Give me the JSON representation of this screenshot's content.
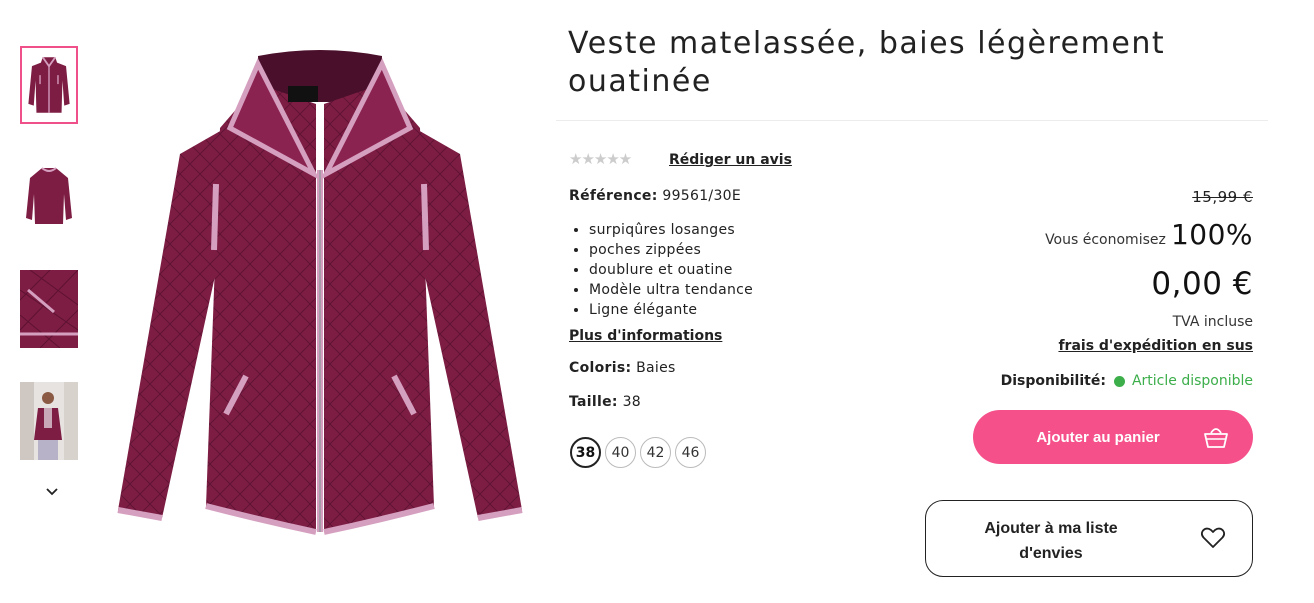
{
  "product": {
    "title": "Veste matelassée, baies légèrement ouatinée",
    "stars": "★★★★★",
    "review_link": "Rédiger un avis",
    "reference_label": "Référence:",
    "reference_value": "99561/30E",
    "features": [
      "surpiqûres losanges",
      "poches zippées",
      "doublure et ouatine",
      "Modèle ultra tendance",
      "Ligne élégante"
    ],
    "more_info": "Plus d'informations",
    "color_label": "Coloris:",
    "color_value": "Baies",
    "size_label": "Taille:",
    "size_value": "38",
    "sizes": [
      "38",
      "40",
      "42",
      "46"
    ],
    "selected_size": "38"
  },
  "pricing": {
    "old_price": "15,99 €",
    "save_label": "Vous économisez",
    "save_percent": "100%",
    "price": "0,00 €",
    "tva": "TVA incluse",
    "shipping": "frais d'expédition en sus",
    "availability_label": "Disponibilité:",
    "availability_text": "Article disponible"
  },
  "actions": {
    "cart": "Ajouter au panier",
    "wishlist": "Ajouter à ma liste d'envies"
  },
  "icons": {
    "thumb_nav": "chevron-down-icon",
    "cart": "basket-icon",
    "wishlist": "heart-icon",
    "availability": "status-dot-icon"
  },
  "colors": {
    "accent": "#f5508a",
    "jacket": "#7e1d43",
    "trim": "#d59fbf",
    "available": "#3cae4a"
  }
}
